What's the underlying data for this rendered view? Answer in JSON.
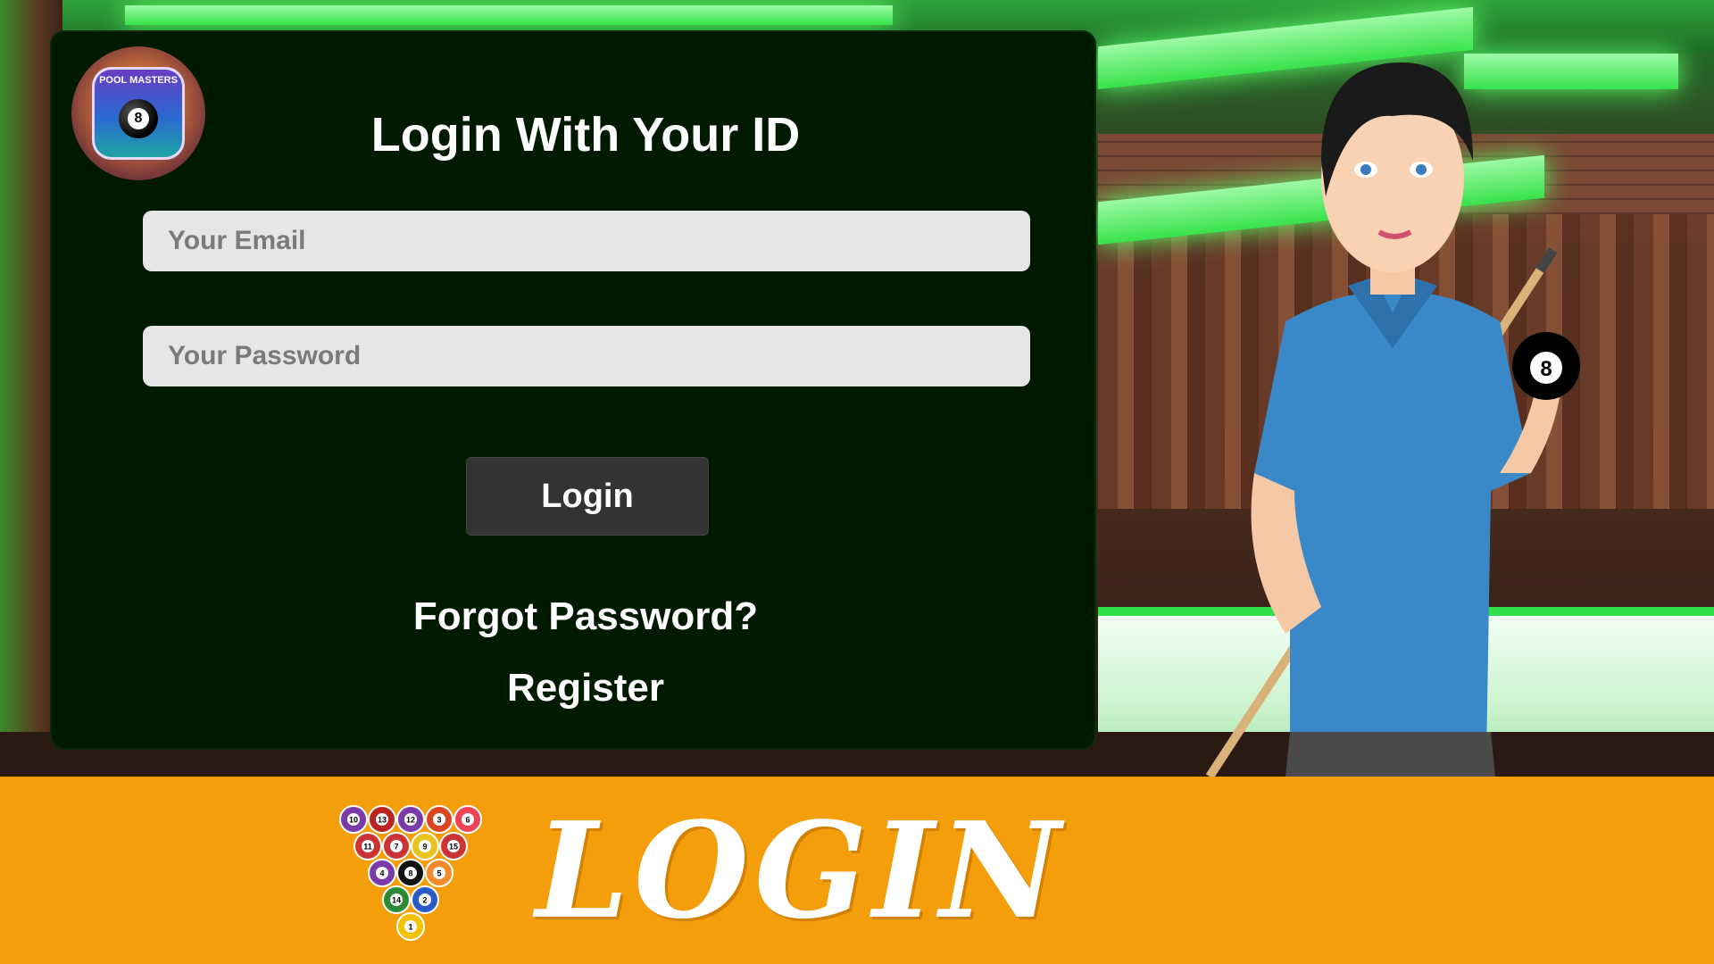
{
  "app": {
    "logo_text": "POOL MASTERS",
    "logo_ball_number": "8"
  },
  "login_panel": {
    "title": "Login With Your ID",
    "email": {
      "placeholder": "Your Email",
      "value": ""
    },
    "password": {
      "placeholder": "Your Password",
      "value": ""
    },
    "login_button": "Login",
    "forgot_link": "Forgot Password?",
    "register_link": "Register"
  },
  "character": {
    "held_ball_number": "8"
  },
  "banner": {
    "title": "LOGIN",
    "rack_balls": [
      "10",
      "13",
      "12",
      "3",
      "6",
      "11",
      "7",
      "9",
      "15",
      "4",
      "8",
      "5",
      "14",
      "2",
      "1"
    ]
  },
  "colors": {
    "panel": "#001a00",
    "banner": "#f59e0b",
    "button": "#333333",
    "field": "#e6e6e6"
  }
}
